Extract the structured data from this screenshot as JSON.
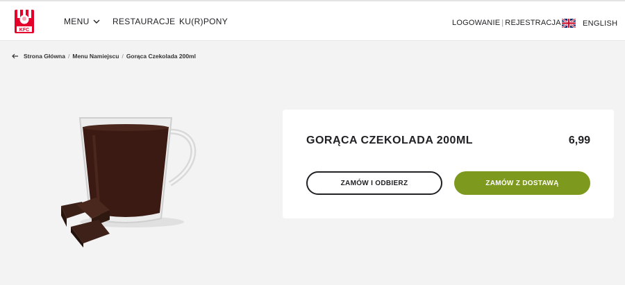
{
  "brand": {
    "logo_alt": "KFC",
    "logo_text": "KFC",
    "accent": "#e4002b"
  },
  "nav": {
    "menu": "MENU",
    "restaurants": "RESTAURACJE",
    "coupons": "KU(R)PONY"
  },
  "auth": {
    "login": "LOGOWANIE",
    "separator": "|",
    "register": "REJESTRACJA"
  },
  "language": {
    "label": "ENGLISH",
    "flag_icon": "uk-flag-icon"
  },
  "breadcrumb": {
    "items": [
      "Strona Główna",
      "Menu Namiejscu",
      "Gorąca Czekolada 200ml"
    ],
    "separator": "/"
  },
  "product": {
    "title": "GORĄCA CZEKOLADA 200ML",
    "price": "6,99",
    "image_alt": "Hot chocolate in a glass cup with chocolate pieces",
    "btn_pickup": "ZAMÓW I ODBIERZ",
    "btn_delivery": "ZAMÓW Z DOSTAWĄ",
    "delivery_color": "#7e9a1e"
  }
}
